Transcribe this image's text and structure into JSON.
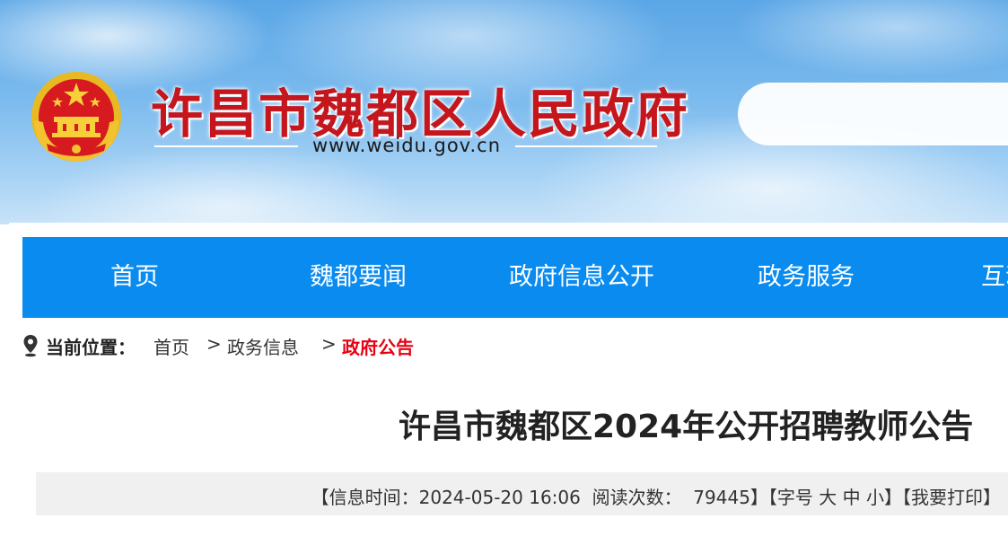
{
  "header": {
    "site_title": "许昌市魏都区人民政府",
    "domain": "www.weidu.gov.cn",
    "colors": {
      "title_red": "#c4161c",
      "sky_blue": "#5aa6e6"
    }
  },
  "nav": {
    "items": [
      {
        "label": "首页"
      },
      {
        "label": "魏都要闻"
      },
      {
        "label": "政府信息公开"
      },
      {
        "label": "政务服务"
      },
      {
        "label": "互动"
      }
    ],
    "color": "#0a8bf0"
  },
  "breadcrumb": {
    "label": "当前位置：",
    "items": [
      "首页",
      "政务信息",
      "政府公告"
    ],
    "separator": ">"
  },
  "article": {
    "title": "许昌市魏都区2024年公开招聘教师公告"
  },
  "info_bar": {
    "time_label": "【信息时间：",
    "time_value": "2024-05-20 16:06",
    "reads_label": "阅读次数：",
    "reads_value": "79445",
    "font_label": "】【字号",
    "font_large": "大",
    "font_medium": "中",
    "font_small": "小",
    "print_label": "】【我要打印】"
  }
}
